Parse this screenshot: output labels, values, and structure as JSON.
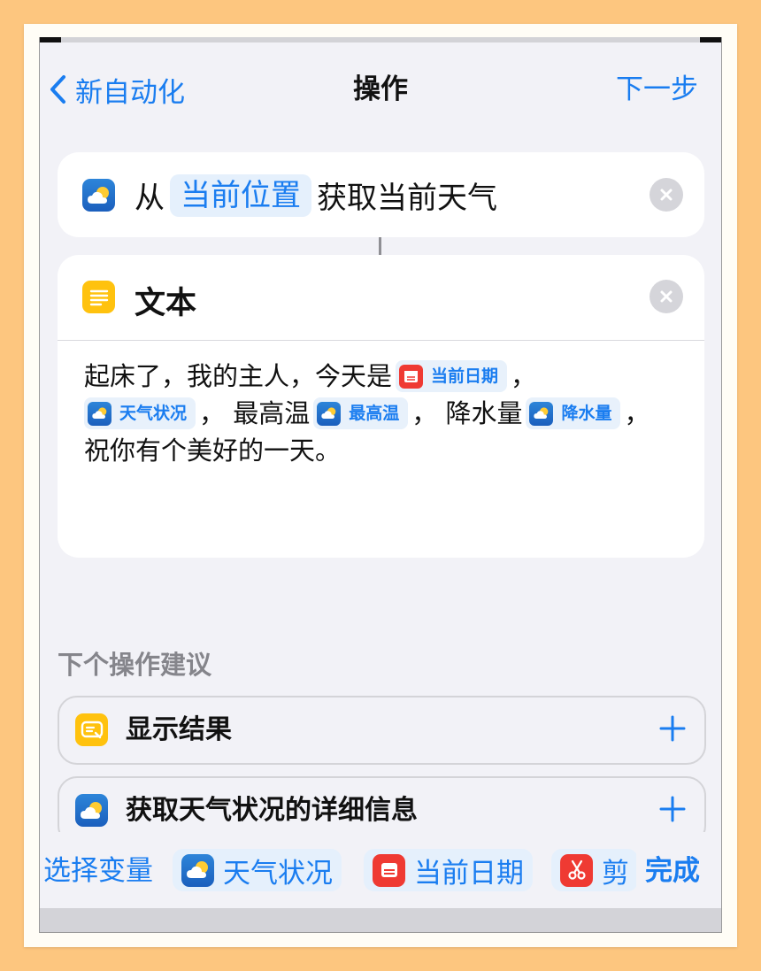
{
  "nav": {
    "back_label": "新自动化",
    "title": "操作",
    "next_label": "下一步"
  },
  "weather_action": {
    "prefix": "从",
    "location_token": "当前位置",
    "suffix": "获取当前天气"
  },
  "text_action": {
    "title": "文本",
    "line1_text": "起床了，我的主人，今天是",
    "line1_token": "当前日期",
    "line1_end": "，",
    "line2_token1": "天气状况",
    "line2_text1": "， 最高温",
    "line2_token2": "最高温",
    "line2_text2": "， 降水量",
    "line2_token3": "降水量",
    "line2_end": "，",
    "line3_text": "祝你有个美好的一天。"
  },
  "suggestions": {
    "title": "下个操作建议",
    "items": [
      {
        "label": "显示结果"
      },
      {
        "label": "获取天气状况的详细信息"
      }
    ]
  },
  "variable_bar": {
    "label": "选择变量",
    "chips": [
      {
        "label": "天气状况"
      },
      {
        "label": "当前日期"
      },
      {
        "label": "剪"
      }
    ],
    "done_label": "完成"
  },
  "colors": {
    "accent": "#1a7df0",
    "background": "#f2f2f7",
    "frame_bg": "#fdc67f"
  }
}
